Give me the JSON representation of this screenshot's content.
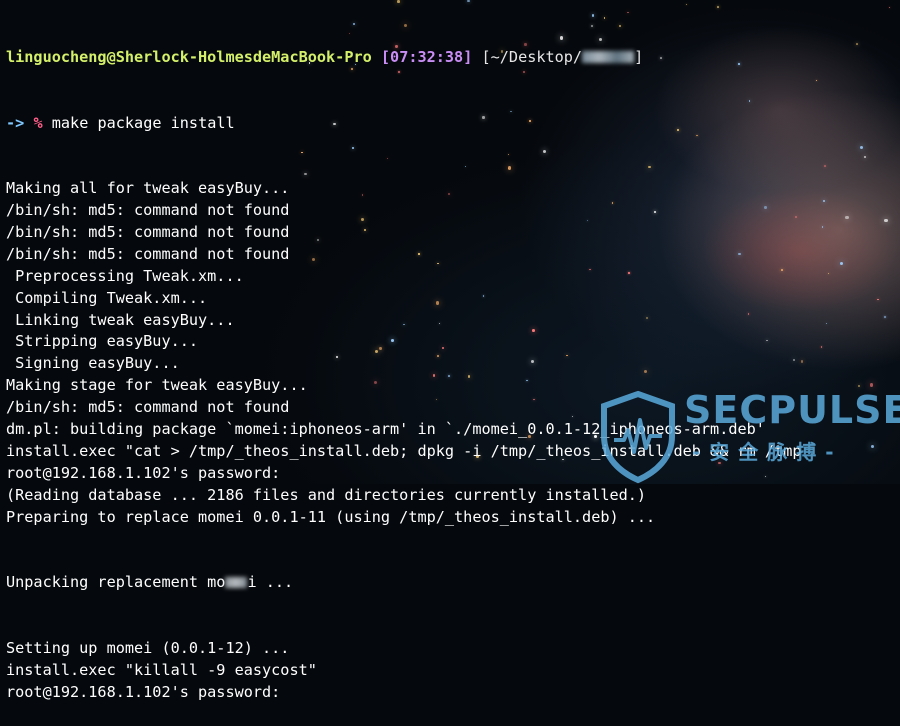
{
  "terminal": {
    "header": {
      "user_host": "linguocheng@Sherlock-HolmesdeMacBook-Pro",
      "time": "[07:32:38]",
      "cwd_prefix": "[~/Desktop/",
      "cwd_suffix": "]"
    },
    "prompt": {
      "arrow": "->",
      "sign": "%",
      "command": "make package install"
    },
    "lines": [
      "Making all for tweak easyBuy...",
      "/bin/sh: md5: command not found",
      "/bin/sh: md5: command not found",
      "/bin/sh: md5: command not found",
      " Preprocessing Tweak.xm...",
      " Compiling Tweak.xm...",
      " Linking tweak easyBuy...",
      " Stripping easyBuy...",
      " Signing easyBuy...",
      "Making stage for tweak easyBuy...",
      "/bin/sh: md5: command not found",
      "dm.pl: building package `momei:iphoneos-arm' in `./momei_0.0.1-12_iphoneos-arm.deb'",
      "install.exec \"cat > /tmp/_theos_install.deb; dpkg -i /tmp/_theos_install.deb && rm /tmp",
      "root@192.168.1.102's password:",
      "(Reading database ... 2186 files and directories currently installed.)",
      "Preparing to replace momei 0.0.1-11 (using /tmp/_theos_install.deb) ..."
    ],
    "unpacking_prefix": "Unpacking replacement mo",
    "unpacking_suffix": "i ...",
    "lines_after": [
      "Setting up momei (0.0.1-12) ...",
      "install.exec \"killall -9 easycost\"",
      "root@192.168.1.102's password:"
    ]
  },
  "watermark": {
    "title": "SECPULSE",
    "subtitle": "-安全脉搏-"
  }
}
